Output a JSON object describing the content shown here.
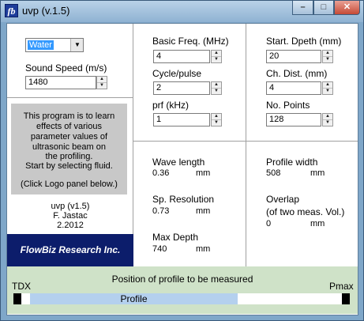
{
  "window": {
    "app_icon": "fb",
    "title": "uvp (v.1.5)",
    "minimize": "–",
    "maximize": "□",
    "close": "✕"
  },
  "fluid": {
    "selected": "Water"
  },
  "sound_speed": {
    "label": "Sound Speed (m/s)",
    "value": "1480"
  },
  "info": {
    "lines": [
      "This program is to learn",
      "effects of various",
      "parameter values of",
      "ultrasonic beam on",
      "the profiling.",
      "Start by selecting fluid.",
      "",
      "(Click Logo panel below.)"
    ]
  },
  "about": {
    "name": "uvp (v1.5)",
    "author": "F. Jastac",
    "date": "2.2012"
  },
  "logo": {
    "text": "FlowBiz Research Inc."
  },
  "inputs_left": [
    {
      "label": "Basic Freq. (MHz)",
      "value": "4"
    },
    {
      "label": "Cycle/pulse",
      "value": "2"
    },
    {
      "label": "prf (kHz)",
      "value": "1"
    }
  ],
  "inputs_right": [
    {
      "label": "Start. Dpeth (mm)",
      "value": "20"
    },
    {
      "label": "Ch. Dist. (mm)",
      "value": "4"
    },
    {
      "label": "No. Points",
      "value": "128"
    }
  ],
  "outputs": {
    "wave_length": {
      "label": "Wave length",
      "value": "0.36",
      "unit": "mm"
    },
    "sp_resolution": {
      "label": "Sp. Resolution",
      "value": "0.73",
      "unit": "mm"
    },
    "max_depth": {
      "label": "Max Depth",
      "value": "740",
      "unit": "mm"
    },
    "profile_width": {
      "label": "Profile width",
      "value": "508",
      "unit": "mm"
    },
    "overlap": {
      "label": "Overlap",
      "sub_label": "(of two meas. Vol.)",
      "value": "0",
      "unit": "mm"
    }
  },
  "profile": {
    "title": "Position of profile to be measured",
    "left_label": "TDX",
    "right_label": "Pmax",
    "bar_label": "Profile",
    "start_fraction": 0.027,
    "end_fraction": 0.676
  },
  "colors": {
    "title_bar": "#8fb2d2",
    "logo_bg": "#0c1d6b",
    "info_bg": "#c8c8c8",
    "bottom_bg": "#cfe2c8",
    "profile_bar": "#b4d0ee",
    "select_highlight": "#3399ff"
  }
}
